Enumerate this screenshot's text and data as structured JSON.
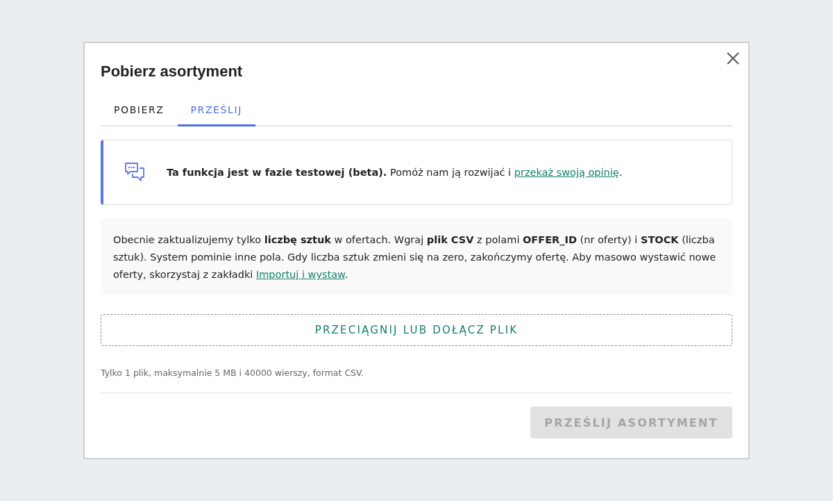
{
  "dialog": {
    "title": "Pobierz asortyment",
    "tabs": [
      {
        "label": "POBIERZ",
        "selected": false
      },
      {
        "label": "PRZEŚLIJ",
        "selected": true
      }
    ],
    "notice": {
      "text": "**Ta funkcja jest w fazie testowej (beta).** Pomóż nam ją rozwijać i ",
      "link": "przekaż swoją opinię",
      "suffix": "."
    },
    "info": {
      "text": "Obecnie zaktualizujemy tylko **liczbę sztuk** w ofertach. Wgraj **plik CSV** z polami **OFFER_ID** (nr oferty) i **STOCK** (liczba sztuk). System pominie inne pola. Gdy liczba sztuk zmieni się na zero, zakończymy ofertę. Aby masowo wystawić nowe oferty, skorzystaj z zakładki ",
      "link": "Importuj i wystaw",
      "suffix": "."
    },
    "dropzone": {
      "label": "PRZECIĄGNIJ LUB DOŁĄCZ PLIK"
    },
    "hint": "Tylko 1 plik, maksymalnie 5 MB i 40000 wierszy, format CSV.",
    "submit": {
      "label": "PRZEŚLIJ ASORTYMENT",
      "disabled": true
    }
  }
}
